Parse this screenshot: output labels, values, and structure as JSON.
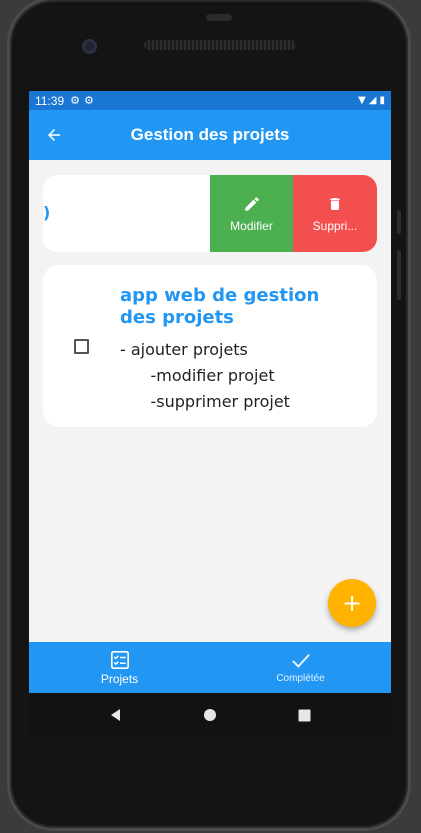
{
  "status_bar": {
    "time": "11:39",
    "left_icons": [
      "gear-icon",
      "gear-icon"
    ],
    "right_icons": [
      "wifi-icon",
      "signal-icon",
      "battery-icon"
    ]
  },
  "app_bar": {
    "title": "Gestion des projets",
    "back_icon": "arrow-back-icon"
  },
  "swiped_card": {
    "peek_text": ")",
    "actions": [
      {
        "label": "Modifier",
        "icon": "pencil-icon",
        "color": "#4caf50"
      },
      {
        "label": "Suppri...",
        "icon": "trash-icon",
        "color": "#f44f4f"
      }
    ]
  },
  "project_card": {
    "title": "app web de gestion des projets",
    "description_lines": [
      "- ajouter projets",
      "      -modifier projet",
      "      -supprimer projet"
    ],
    "checked": false
  },
  "fab": {
    "icon": "plus-icon",
    "color": "#ffb300"
  },
  "bottom_nav": {
    "items": [
      {
        "label": "Projets",
        "icon": "checklist-icon",
        "active": true
      },
      {
        "label": "Complétée",
        "icon": "check-icon",
        "active": false
      }
    ]
  },
  "colors": {
    "primary": "#2196f3",
    "status_bar": "#1976d2",
    "background": "#f3f3f3"
  }
}
